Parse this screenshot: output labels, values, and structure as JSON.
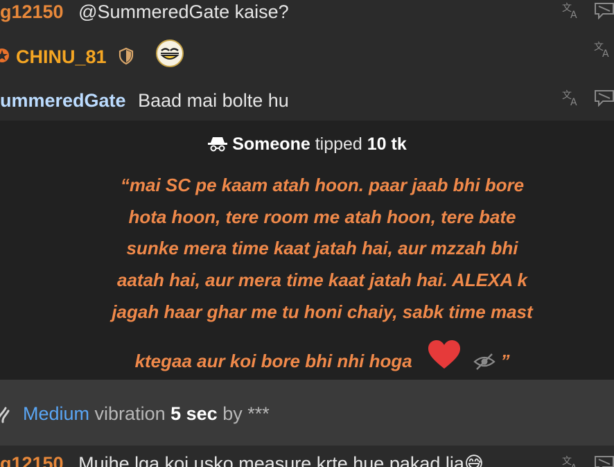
{
  "messages": [
    {
      "user": "g12150",
      "text": "@SummeredGate  kaise?",
      "user_color": "#e8883a"
    },
    {
      "user": "CHINU_81",
      "text": "",
      "user_color": "#f5a623"
    },
    {
      "user": "ummeredGate",
      "text": "Baad mai bolte hu",
      "user_color": "#bcdcff"
    },
    {
      "user": "g12150",
      "text": "Mujhe lga koi usko measure krte hue pakad lia😅",
      "user_color": "#e8883a"
    }
  ],
  "tip": {
    "sender": "Someone",
    "verb": "tipped",
    "amount": "10 tk",
    "quote_lines": [
      "“mai SC pe kaam atah hoon. paar jaab bhi bore",
      "hota hoon, tere room me atah hoon, tere bate",
      "sunke mera time kaat jatah hai, aur mzzah bhi",
      "aatah hai, aur mera time kaat jatah hai. ALEXA k",
      "jagah haar ghar me tu honi chaiy, sabk time mast",
      "ktegaa aur koi bore bhi nhi hoga"
    ],
    "quote_end": "”",
    "quote_color": "#f0894a"
  },
  "vibration": {
    "level": "Medium",
    "word": "vibration",
    "duration": "5 sec",
    "by": "by",
    "user": "***",
    "level_color": "#5aa6f5"
  },
  "icons": {
    "translate": "translate-icon",
    "report": "report-icon",
    "incognito": "incognito-icon",
    "heart": "heart-icon",
    "hidden": "eye-slash-icon",
    "vibration": "vibration-icon",
    "shield": "shield-icon",
    "star": "star-badge-icon",
    "emoji": "emoji-icon"
  }
}
